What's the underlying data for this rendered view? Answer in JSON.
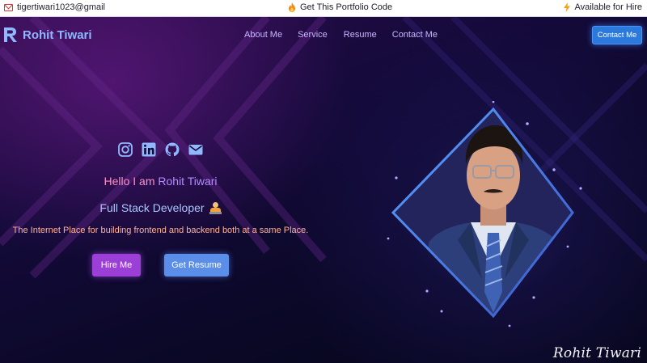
{
  "topbar": {
    "email": "tigertiwari1023@gmail",
    "code": "Get This Portfolio Code",
    "hire": "Available for Hire",
    "icons": {
      "email": "mail-icon",
      "code": "fire-icon",
      "hire": "lightning-icon"
    }
  },
  "nav": {
    "brand": "Rohit Tiwari",
    "links": [
      "About Me",
      "Service",
      "Resume",
      "Contact Me"
    ],
    "cta": "Contact Me"
  },
  "hero": {
    "socials": [
      "instagram-icon",
      "linkedin-icon",
      "github-icon",
      "email-icon"
    ],
    "greeting": "Hello I am",
    "name": "Rohit Tiwari",
    "role": "Full Stack Developer",
    "tagline": "The Internet Place for building frontend and backend both at a same Place.",
    "primary_button": "Hire Me",
    "secondary_button": "Get Resume"
  },
  "signature": "Rohit Tiwari",
  "colors": {
    "accent_blue": "#2c79dc",
    "accent_purple": "#9b3fd6",
    "brand_text": "#8fb8ff",
    "greeting_pink": "#ff8fc6",
    "name_purple": "#b38cff"
  }
}
